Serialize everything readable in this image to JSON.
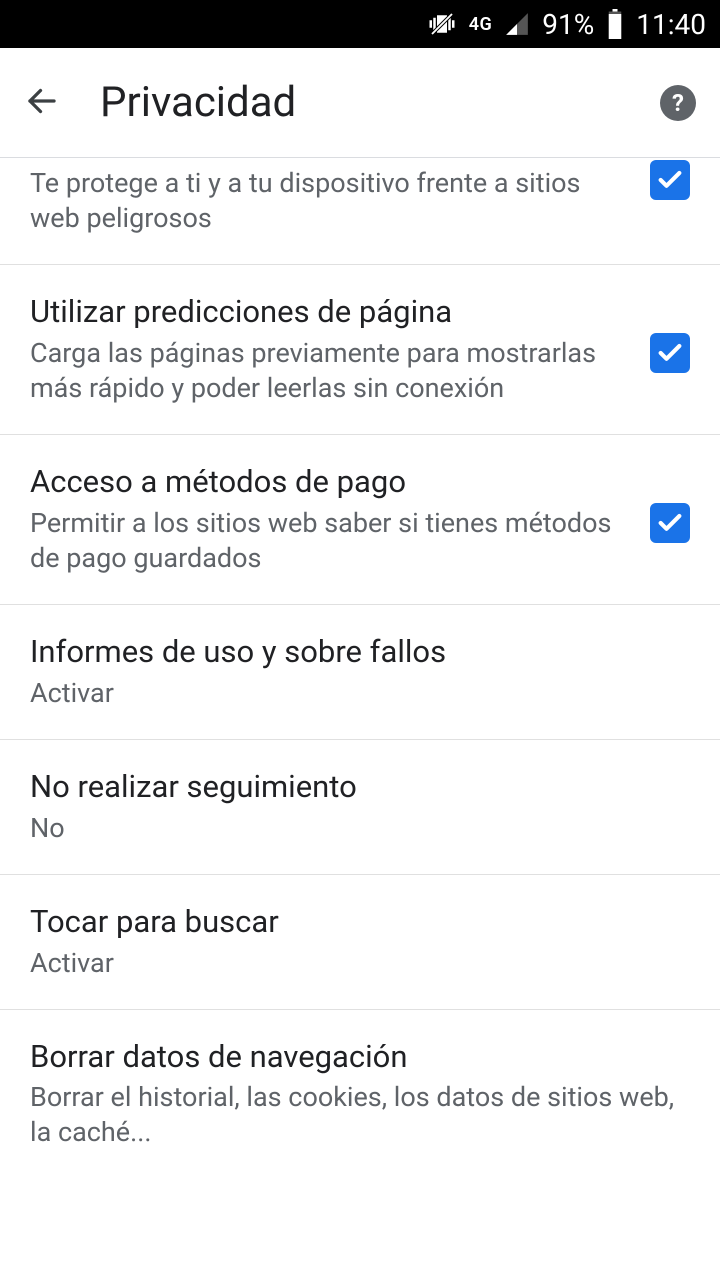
{
  "statusbar": {
    "network": "4G",
    "battery": "91%",
    "time": "11:40"
  },
  "header": {
    "title": "Privacidad"
  },
  "items": [
    {
      "title": "",
      "desc": "Te protege a ti y a tu dispositivo frente a sitios web peligrosos",
      "checked": true
    },
    {
      "title": "Utilizar predicciones de página",
      "desc": "Carga las páginas previamente para mostrarlas más rápido y poder leerlas sin conexión",
      "checked": true
    },
    {
      "title": "Acceso a métodos de pago",
      "desc": "Permitir a los sitios web saber si tienes métodos de pago guardados",
      "checked": true
    },
    {
      "title": "Informes de uso y sobre fallos",
      "desc": "Activar"
    },
    {
      "title": "No realizar seguimiento",
      "desc": "No"
    },
    {
      "title": "Tocar para buscar",
      "desc": "Activar"
    },
    {
      "title": "Borrar datos de navegación",
      "desc": "Borrar el historial, las cookies, los datos de sitios web, la caché..."
    }
  ]
}
